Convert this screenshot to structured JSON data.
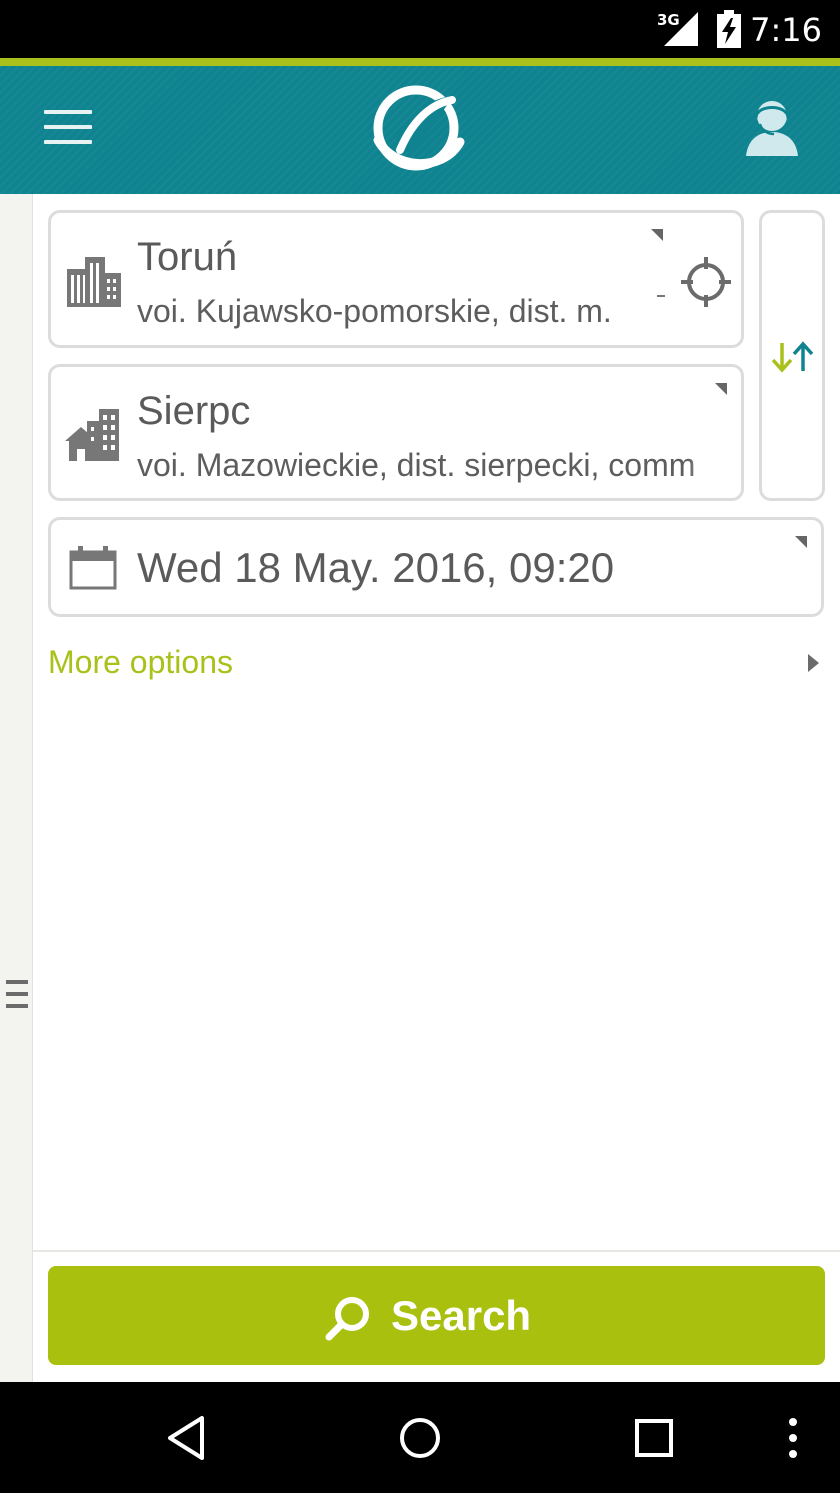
{
  "status_bar": {
    "network": "3G",
    "time": "7:16"
  },
  "app_bar": {
    "menu_icon": "hamburger-menu-icon",
    "logo": "app-logo",
    "support_icon": "support-agent-icon"
  },
  "search_form": {
    "from": {
      "title": "Toruń",
      "subtitle": "voi. Kujawsko-pomorskie, dist. m.",
      "icon": "city-buildings-icon",
      "action_icon": "locate-crosshair-icon"
    },
    "to": {
      "title": "Sierpc",
      "subtitle": "voi. Mazowieckie, dist. sierpecki, comm",
      "icon": "town-buildings-icon"
    },
    "swap_icon": "swap-arrows-icon",
    "date": {
      "value": "Wed 18 May. 2016, 09:20",
      "icon": "calendar-icon"
    },
    "more_options_label": "More options"
  },
  "search_button": {
    "label": "Search",
    "icon": "search-icon"
  },
  "colors": {
    "app_bar": "#0f8390",
    "accent": "#a9c11a",
    "search_button": "#a9c10e",
    "border": "#dcdcdc"
  }
}
